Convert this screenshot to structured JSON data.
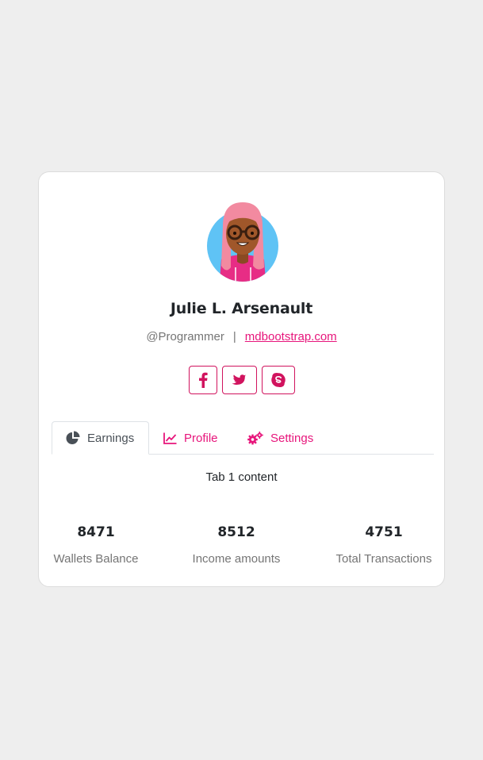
{
  "profile": {
    "name": "Julie L. Arsenault",
    "handle": "@Programmer",
    "separator": "|",
    "website": "mdbootstrap.com"
  },
  "socials": [
    {
      "icon": "facebook-icon"
    },
    {
      "icon": "twitter-icon"
    },
    {
      "icon": "skype-icon"
    }
  ],
  "tabs": [
    {
      "label": "Earnings",
      "icon": "pie-chart-icon",
      "active": true
    },
    {
      "label": "Profile",
      "icon": "line-chart-icon",
      "active": false
    },
    {
      "label": "Settings",
      "icon": "gears-icon",
      "active": false
    }
  ],
  "tab_content": "Tab 1 content",
  "stats": [
    {
      "value": "8471",
      "label": "Wallets Balance"
    },
    {
      "value": "8512",
      "label": "Income amounts"
    },
    {
      "value": "4751",
      "label": "Total Transactions"
    }
  ],
  "colors": {
    "accent": "#e7157b",
    "background": "#eeeeee",
    "card": "#ffffff",
    "muted_text": "#757575"
  }
}
